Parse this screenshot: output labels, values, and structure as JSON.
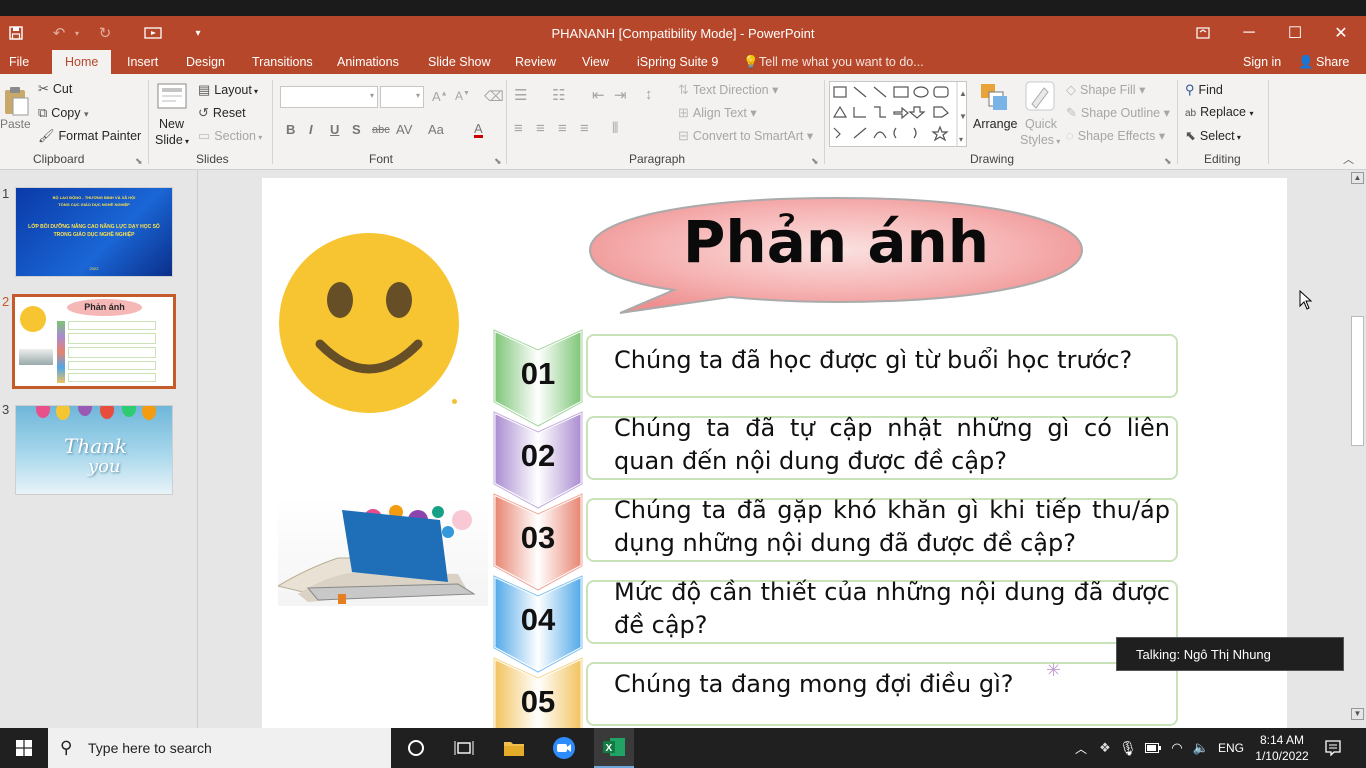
{
  "window": {
    "title": "PHANANH [Compatibility Mode] - PowerPoint",
    "restore_icon": "ribbon-display-icon",
    "min": "─",
    "max": "☐",
    "close": "✕"
  },
  "menu": {
    "file": "File",
    "home": "Home",
    "insert": "Insert",
    "design": "Design",
    "transitions": "Transitions",
    "animations": "Animations",
    "slideshow": "Slide Show",
    "review": "Review",
    "view": "View",
    "ispring": "iSpring Suite 9",
    "tellme": "Tell me what you want to do...",
    "signin": "Sign in",
    "share": "Share"
  },
  "ribbon": {
    "clipboard": {
      "paste": "Paste",
      "cut": "Cut",
      "copy": "Copy",
      "format_painter": "Format Painter",
      "label": "Clipboard"
    },
    "slides": {
      "new_slide": "New",
      "new_slide2": "Slide",
      "layout": "Layout",
      "reset": "Reset",
      "section": "Section",
      "label": "Slides"
    },
    "font": {
      "label": "Font",
      "bold": "B",
      "italic": "I",
      "underline": "U",
      "shadow": "S",
      "strike": "abc",
      "spacing": "AV",
      "case": "Aa",
      "color": "A"
    },
    "paragraph": {
      "label": "Paragraph",
      "text_direction": "Text Direction",
      "align_text": "Align Text",
      "smartart": "Convert to SmartArt"
    },
    "drawing": {
      "label": "Drawing",
      "arrange": "Arrange",
      "quick_styles": "Quick",
      "quick_styles2": "Styles",
      "shape_fill": "Shape Fill",
      "shape_outline": "Shape Outline",
      "shape_effects": "Shape Effects"
    },
    "editing": {
      "label": "Editing",
      "find": "Find",
      "replace": "Replace",
      "select": "Select"
    }
  },
  "thumbs": [
    {
      "num": "1",
      "line1": "BỘ LAO ĐỘNG - THƯƠNG BINH VÀ XÃ HỘI",
      "line2": "TỔNG CỤC GIÁO DỤC NGHỀ NGHIỆP",
      "line3": "LỚP BỒI DƯỠNG NÂNG CAO NĂNG LỰC DẠY HỌC SỐ",
      "line4": "TRONG GIÁO DỤC NGHỀ NGHIỆP",
      "year": "2022"
    },
    {
      "num": "2",
      "title": "Phản ánh"
    },
    {
      "num": "3",
      "text1": "Thank",
      "text2": "you"
    }
  ],
  "slide": {
    "title": "Phản ánh",
    "questions": [
      {
        "num": "01",
        "text": "Chúng ta đã học được gì từ buổi học trước?",
        "color": "#7cc576"
      },
      {
        "num": "02",
        "text": "Chúng ta đã tự cập nhật những gì có liên quan đến nội dung được đề cập?",
        "color": "#a98bd0"
      },
      {
        "num": "03",
        "text": "Chúng ta đã gặp khó khăn gì khi tiếp thu/áp dụng những nội dung đã được đề cập?",
        "color": "#e8836f"
      },
      {
        "num": "04",
        "text": "Mức độ cần thiết của những nội dung đã được đề cập?",
        "color": "#4fa8e8"
      },
      {
        "num": "05",
        "text": "Chúng ta đang mong đợi điều gì?",
        "color": "#f2c25c"
      }
    ]
  },
  "talking": "Talking: Ngô Thị Nhung",
  "taskbar": {
    "search": "Type here to search",
    "lang": "ENG",
    "time": "8:14 AM",
    "date": "1/10/2022"
  }
}
